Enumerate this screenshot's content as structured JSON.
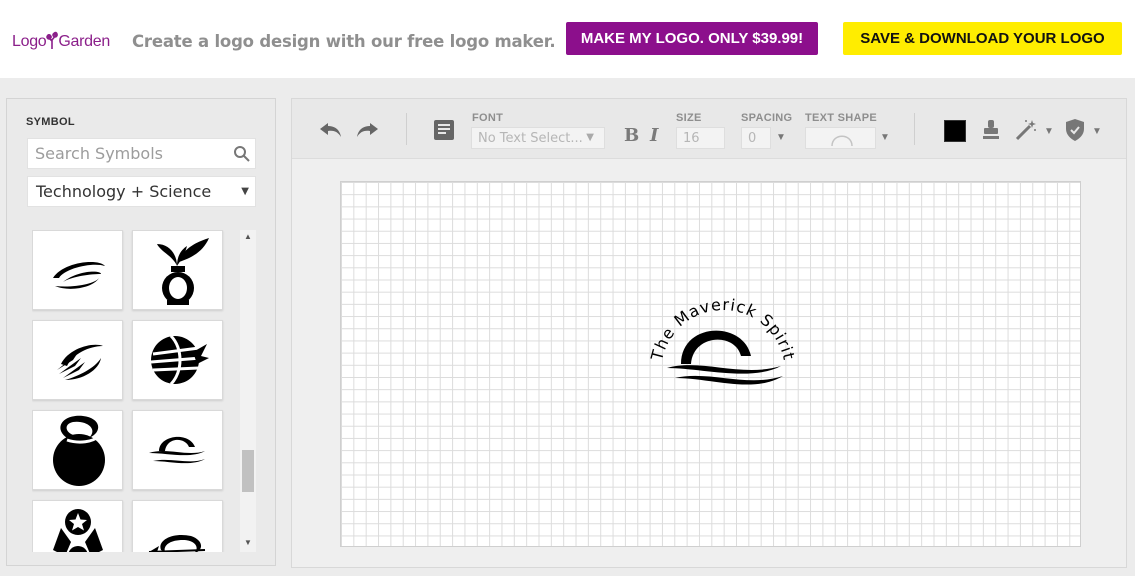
{
  "header": {
    "logo_text": "Logo Garden",
    "tagline": "Create a logo design with our free logo maker.",
    "make_logo_button": "MAKE MY LOGO. ONLY $39.99!",
    "save_download_button": "SAVE & DOWNLOAD YOUR LOGO",
    "colors": {
      "brand_purple": "#8c0f8c",
      "cta_yellow": "#ffed00"
    }
  },
  "symbol_panel": {
    "title": "SYMBOL",
    "search_placeholder": "Search Symbols",
    "category": "Technology + Science",
    "symbols": [
      {
        "name": "swoosh-orbit-icon"
      },
      {
        "name": "plant-vase-icon"
      },
      {
        "name": "comet-streak-icon"
      },
      {
        "name": "striped-globe-icon"
      },
      {
        "name": "spiral-bulb-icon"
      },
      {
        "name": "sunrise-waves-icon"
      },
      {
        "name": "star-figure-icon"
      },
      {
        "name": "arrow-orbit-icon"
      }
    ]
  },
  "toolbar": {
    "font_label": "FONT",
    "font_value": "No Text Select...",
    "size_label": "SIZE",
    "size_value": "16",
    "spacing_label": "SPACING",
    "spacing_value": "0",
    "text_shape_label": "TEXT SHAPE",
    "bold_label": "B",
    "italic_label": "I",
    "color_swatch": "#000000"
  },
  "canvas": {
    "logo_text": "The Maverick Spirit"
  }
}
